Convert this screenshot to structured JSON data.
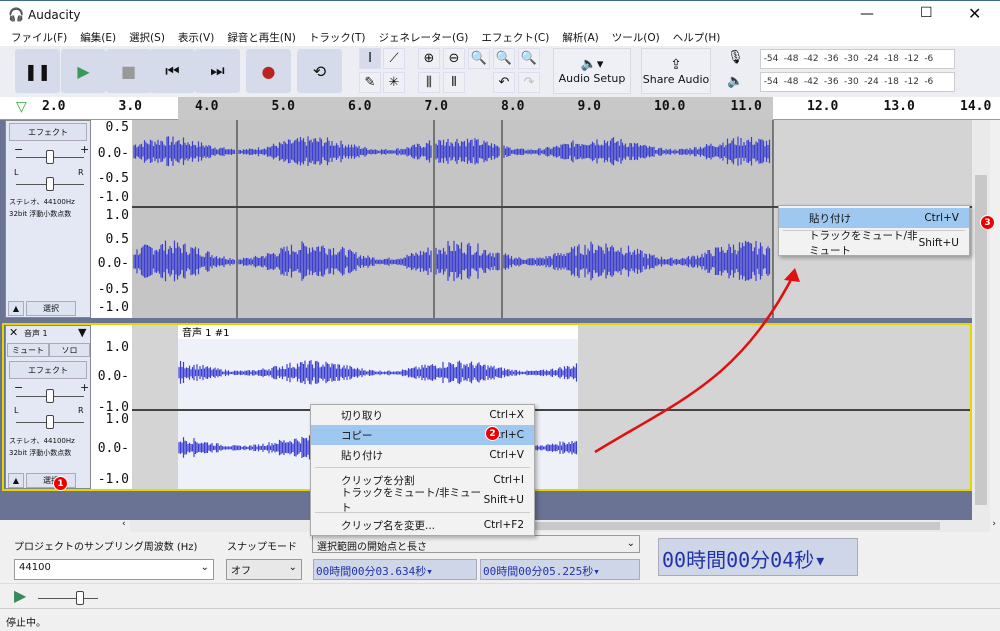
{
  "window": {
    "title": "Audacity"
  },
  "menu": [
    "ファイル(F)",
    "編集(E)",
    "選択(S)",
    "表示(V)",
    "録音と再生(N)",
    "トラック(T)",
    "ジェネレーター(G)",
    "エフェクト(C)",
    "解析(A)",
    "ツール(O)",
    "ヘルプ(H)"
  ],
  "toolbar": {
    "audio_setup": "Audio Setup",
    "share_audio": "Share Audio",
    "meter_ticks": [
      "-54",
      "-48",
      "-42",
      "-36",
      "-30",
      "-24",
      "-18",
      "-12",
      "-6"
    ],
    "meter_lr": [
      "L",
      "R"
    ]
  },
  "ruler": {
    "ticks": [
      "2.0",
      "3.0",
      "4.0",
      "5.0",
      "6.0",
      "7.0",
      "8.0",
      "9.0",
      "10.0",
      "11.0",
      "12.0",
      "13.0",
      "14.0"
    ]
  },
  "track1": {
    "effect": "エフェクト",
    "gain_minus": "−",
    "gain_plus": "+",
    "pan_l": "L",
    "pan_r": "R",
    "info1": "ステレオ、44100Hz",
    "info2": "32bit 浮動小数点数",
    "select": "選択",
    "scale_top": [
      "0.5",
      "0.0-",
      "-0.5",
      "-1.0"
    ],
    "scale_bottom": [
      "1.0",
      "0.5",
      "0.0-",
      "-0.5",
      "-1.0"
    ]
  },
  "track2": {
    "name": "音声 1",
    "mute": "ミュート",
    "solo": "ソロ",
    "effect": "エフェクト",
    "gain_minus": "−",
    "gain_plus": "+",
    "pan_l": "L",
    "pan_r": "R",
    "info1": "ステレオ、44100Hz",
    "info2": "32bit 浮動小数点数",
    "select": "選択",
    "clip_name": "音声 1 #1",
    "scale": [
      "1.0",
      "0.0-",
      "-1.0"
    ]
  },
  "context_menu_clip": [
    {
      "label": "切り取り",
      "shortcut": "Ctrl+X"
    },
    {
      "label": "コピー",
      "shortcut": "Ctrl+C",
      "highlighted": true
    },
    {
      "label": "貼り付け",
      "shortcut": "Ctrl+V"
    },
    {
      "label": "クリップを分割",
      "shortcut": "Ctrl+I"
    },
    {
      "label": "トラックをミュート/非ミュート",
      "shortcut": "Shift+U"
    },
    {
      "label": "クリップ名を変更...",
      "shortcut": "Ctrl+F2"
    }
  ],
  "context_menu_track": [
    {
      "label": "貼り付け",
      "shortcut": "Ctrl+V",
      "highlighted": true
    },
    {
      "label": "トラックをミュート/非ミュート",
      "shortcut": "Shift+U"
    }
  ],
  "badges": [
    "1",
    "2",
    "3"
  ],
  "bottom": {
    "rate_label": "プロジェクトのサンプリング周波数 (Hz)",
    "snap_label": "スナップモード",
    "rate_value": "44100",
    "snap_value": "オフ",
    "selection_mode": "選択範囲の開始点と長さ",
    "start": "00時間00分03.634秒",
    "length": "00時間00分05.225秒",
    "position": "00時間00分04秒"
  },
  "status": "停止中。",
  "colors": {
    "waveform": "#3b3fcf",
    "accent_arrow": "#e01010",
    "selected_track_border": "#e6d600"
  }
}
